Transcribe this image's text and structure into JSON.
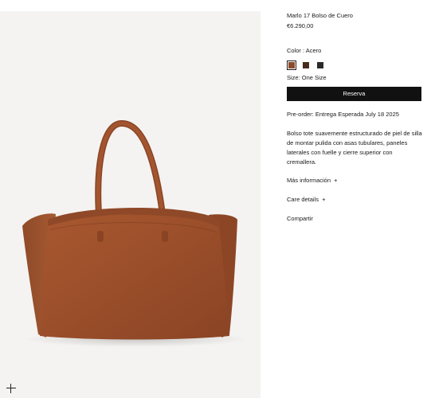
{
  "product": {
    "title": "Marlo 17 Bolso de Cuero",
    "price": "€6.290,00",
    "color_label": "Color : Acero",
    "swatches": [
      {
        "name": "Acero",
        "color": "#8a4a2c",
        "selected": true
      },
      {
        "name": "swatch-2",
        "color": "#4a2a1c",
        "selected": false
      },
      {
        "name": "swatch-3",
        "color": "#2a2a2a",
        "selected": false
      }
    ],
    "size_label": "Size: One Size",
    "reserve_label": "Reserva",
    "preorder": "Pre-order: Entrega Esperada July 18 2025",
    "description": "Bolso tote suavemente estructurado de piel de silla de montar pulida con asas tubulares, paneles laterales con fuelle y cierre superior con cremallera.",
    "more_info": "Más información",
    "care_details": "Care details",
    "plus": "+",
    "share": "Compartir"
  },
  "colors": {
    "gallery_bg": "#f4f3f1",
    "leather": "#a0522d",
    "leather_dark": "#7c3d22",
    "button_bg": "#111111"
  }
}
